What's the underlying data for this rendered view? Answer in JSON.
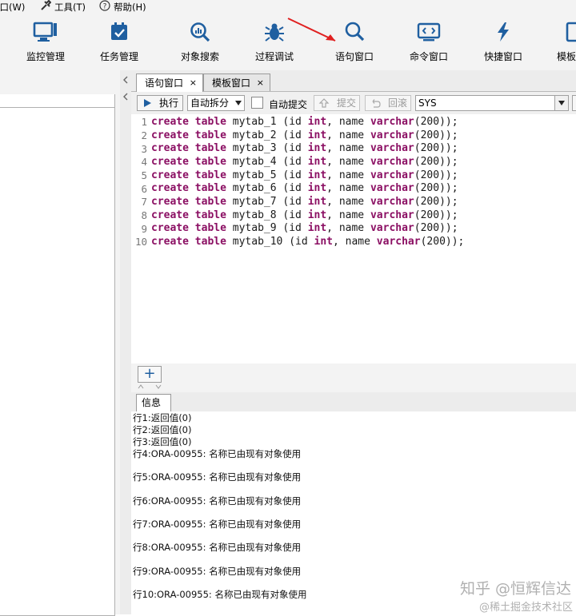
{
  "menu": {
    "items": [
      {
        "label": "窗口(W)"
      },
      {
        "label": "工具(T)"
      },
      {
        "label": "帮助(H)"
      }
    ]
  },
  "toolbar": {
    "buttons": [
      {
        "label": "监控管理",
        "icon": "monitor-icon"
      },
      {
        "label": "任务管理",
        "icon": "calendar-check-icon"
      },
      {
        "label": "对象搜索",
        "icon": "search-chart-icon"
      },
      {
        "label": "过程调试",
        "icon": "bug-icon"
      },
      {
        "label": "语句窗口",
        "icon": "magnifier-icon"
      },
      {
        "label": "命令窗口",
        "icon": "console-icon"
      },
      {
        "label": "快捷窗口",
        "icon": "lightning-icon"
      },
      {
        "label": "模板",
        "icon": "template-icon"
      }
    ],
    "accent": "#1f5fa0"
  },
  "tabs": [
    {
      "label": "语句窗口",
      "close": "×"
    },
    {
      "label": "模板窗口",
      "close": "×"
    }
  ],
  "editor_toolbar": {
    "execute": "执行",
    "split_mode": "自动拆分",
    "autocommit": "自动提交",
    "commit": "提交",
    "rollback": "回滚",
    "schema": "SYS"
  },
  "code": {
    "lines": [
      {
        "n": "1",
        "kw1": "create",
        "kw2": "table",
        "name": " mytab_1 (id ",
        "t1": "int",
        "mid": ", name ",
        "t2": "varchar",
        "tail": "(200));"
      },
      {
        "n": "2",
        "kw1": "create",
        "kw2": "table",
        "name": " mytab_2 (id ",
        "t1": "int",
        "mid": ", name ",
        "t2": "varchar",
        "tail": "(200));"
      },
      {
        "n": "3",
        "kw1": "create",
        "kw2": "table",
        "name": " mytab_3 (id ",
        "t1": "int",
        "mid": ", name ",
        "t2": "varchar",
        "tail": "(200));"
      },
      {
        "n": "4",
        "kw1": "create",
        "kw2": "table",
        "name": " mytab_4 (id ",
        "t1": "int",
        "mid": ", name ",
        "t2": "varchar",
        "tail": "(200));"
      },
      {
        "n": "5",
        "kw1": "create",
        "kw2": "table",
        "name": " mytab_5 (id ",
        "t1": "int",
        "mid": ", name ",
        "t2": "varchar",
        "tail": "(200));"
      },
      {
        "n": "6",
        "kw1": "create",
        "kw2": "table",
        "name": " mytab_6 (id ",
        "t1": "int",
        "mid": ", name ",
        "t2": "varchar",
        "tail": "(200));"
      },
      {
        "n": "7",
        "kw1": "create",
        "kw2": "table",
        "name": " mytab_7 (id ",
        "t1": "int",
        "mid": ", name ",
        "t2": "varchar",
        "tail": "(200));"
      },
      {
        "n": "8",
        "kw1": "create",
        "kw2": "table",
        "name": " mytab_8 (id ",
        "t1": "int",
        "mid": ", name ",
        "t2": "varchar",
        "tail": "(200));"
      },
      {
        "n": "9",
        "kw1": "create",
        "kw2": "table",
        "name": " mytab_9 (id ",
        "t1": "int",
        "mid": ", name ",
        "t2": "varchar",
        "tail": "(200));"
      },
      {
        "n": "10",
        "kw1": "create",
        "kw2": "table",
        "name": " mytab_10 (id ",
        "t1": "int",
        "mid": ", name ",
        "t2": "varchar",
        "tail": "(200));"
      }
    ]
  },
  "add_button": "+",
  "info": {
    "tab_label": "信息",
    "messages": [
      "行1:返回值(0)",
      "行2:返回值(0)",
      "行3:返回值(0)",
      "行4:ORA-00955: 名称已由现有对象使用",
      "行5:ORA-00955: 名称已由现有对象使用",
      "行6:ORA-00955: 名称已由现有对象使用",
      "行7:ORA-00955: 名称已由现有对象使用",
      "行8:ORA-00955: 名称已由现有对象使用",
      "行9:ORA-00955: 名称已由现有对象使用",
      "行10:ORA-00955: 名称已由现有对象使用"
    ]
  },
  "watermark": {
    "line1": "知乎 @恒辉信达",
    "line2": "@稀土掘金技术社区"
  }
}
